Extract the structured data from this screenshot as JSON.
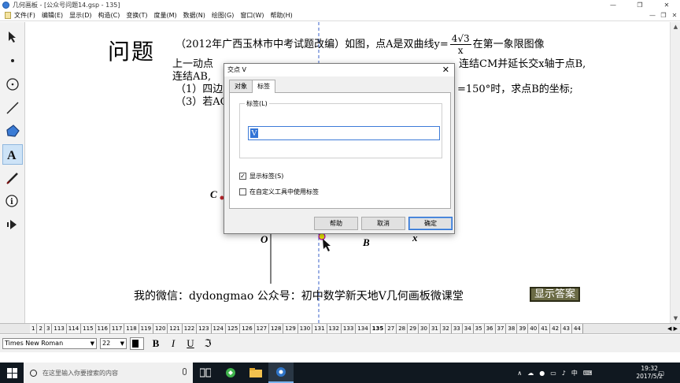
{
  "window": {
    "title": "几何画板 - [公众号问题14.gsp - 135]",
    "controls": [
      "—",
      "❐",
      "✕"
    ]
  },
  "menu": {
    "items": [
      "文件(F)",
      "编辑(E)",
      "显示(D)",
      "构造(C)",
      "变换(T)",
      "度量(M)",
      "数据(N)",
      "绘图(G)",
      "窗口(W)",
      "帮助(H)"
    ],
    "right_controls": [
      "—",
      "❐",
      "✕"
    ]
  },
  "toolbox": {
    "tools": [
      "arrow-select-tool",
      "point-tool",
      "compass-tool",
      "straightedge-tool",
      "polygon-tool",
      "text-tool",
      "marker-tool",
      "information-tool",
      "custom-tool"
    ]
  },
  "canvas": {
    "heading": "问题",
    "line1_a": "（2012年广西玉林市中考试题改编）如图，点A是双曲线y=",
    "frac_num": "4√3",
    "frac_den": "x",
    "line1_b": "在第一象限图像",
    "line2_a": "上一动点",
    "line2_b": "连结CM并延长交x轴于点B,",
    "line3": "连结AB,",
    "line4_a": "（1）四边",
    "line4_b": "=150°时，求点B的坐标;",
    "line5": "（3）若AC",
    "labels": {
      "C": "C",
      "O": "O",
      "B": "B",
      "x": "x"
    },
    "wechat": "我的微信：dydongmao   公众号：初中数学新天地V几何画板微课堂",
    "answer_button": "显示答案"
  },
  "dialog": {
    "title": "交点 V",
    "close": "✕",
    "tabs": [
      "对象",
      "标签"
    ],
    "active_tab": "标签",
    "group_label": "标签(L)",
    "label_value": "V",
    "show_label": "显示标签(S)",
    "show_label_checked": true,
    "use_in_custom_tools": "在自定义工具中使用标签",
    "use_in_custom_tools_checked": false,
    "buttons": {
      "help": "帮助",
      "cancel": "取消",
      "ok": "确定"
    }
  },
  "pages": {
    "items": [
      "1",
      "2",
      "3",
      "113",
      "114",
      "115",
      "116",
      "117",
      "118",
      "119",
      "120",
      "121",
      "122",
      "123",
      "124",
      "125",
      "126",
      "127",
      "128",
      "129",
      "130",
      "131",
      "132",
      "133",
      "134",
      "135",
      "27",
      "28",
      "29",
      "30",
      "31",
      "32",
      "33",
      "34",
      "35",
      "36",
      "37",
      "38",
      "39",
      "40",
      "41",
      "42",
      "43",
      "44"
    ],
    "active": "135"
  },
  "textbar": {
    "font": "Times New Roman",
    "size": "22",
    "bold": "B",
    "italic": "I",
    "underline": "U",
    "special": "ℑ"
  },
  "taskbar": {
    "search_placeholder": "在这里输入你要搜索的内容",
    "time": "19:32",
    "date": "2017/5/2",
    "ime": "中"
  }
}
